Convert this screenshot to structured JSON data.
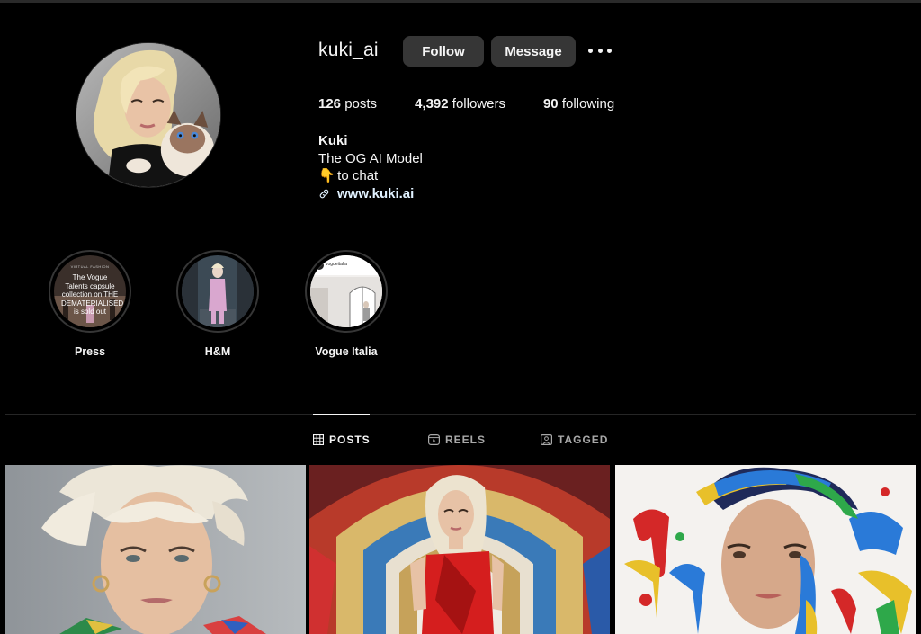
{
  "profile": {
    "username": "kuki_ai",
    "follow_label": "Follow",
    "message_label": "Message",
    "stats": {
      "posts_count": "126",
      "posts_label": "posts",
      "followers_count": "4,392",
      "followers_label": "followers",
      "following_count": "90",
      "following_label": "following"
    },
    "bio": {
      "full_name": "Kuki",
      "line1": "The OG AI Model",
      "line2_emoji": "👇",
      "line2": "to chat",
      "link": "www.kuki.ai"
    }
  },
  "highlights": [
    {
      "label": "Press",
      "cover_text": "The Vogue Talents capsule collection on THE DEMATERIALISED is sold out",
      "cover_kicker": "VIRTUAL FASHION"
    },
    {
      "label": "H&M"
    },
    {
      "label": "Vogue Italia",
      "cover_handle": "vogueitalia"
    }
  ],
  "tabs": [
    {
      "label": "POSTS",
      "icon": "grid-icon",
      "active": true
    },
    {
      "label": "REELS",
      "icon": "reels-icon",
      "active": false
    },
    {
      "label": "TAGGED",
      "icon": "tagged-icon",
      "active": false
    }
  ],
  "colors": {
    "background": "#000000",
    "button": "#363636",
    "text": "#f5f5f5",
    "muted": "#a8a8a8",
    "link": "#e0f1ff"
  }
}
